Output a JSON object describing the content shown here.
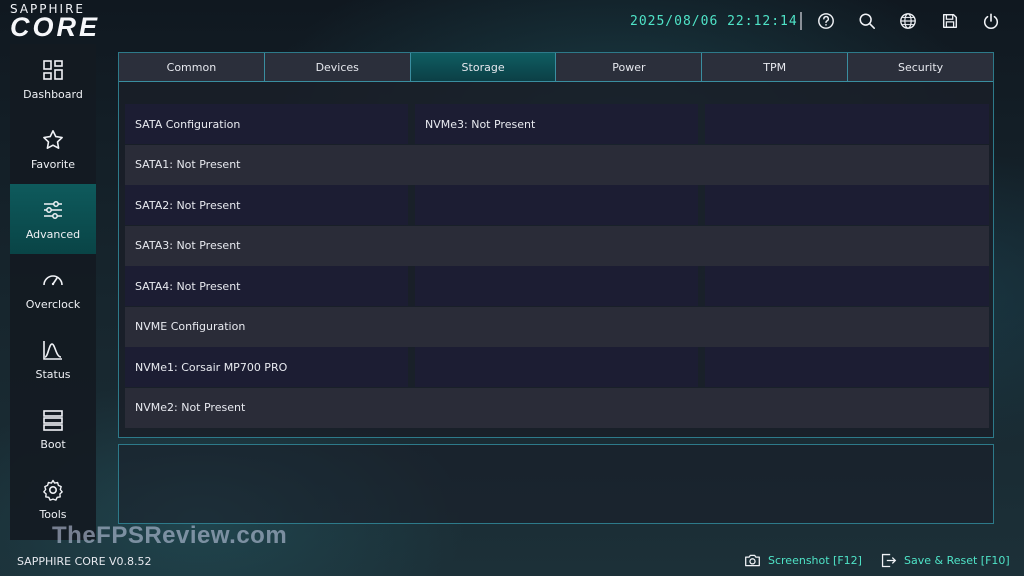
{
  "brand": {
    "top": "SAPPHIRE",
    "main": "CORE"
  },
  "datetime": "2025/08/06 22:12:14",
  "top_icons": [
    "help-icon",
    "search-icon",
    "globe-icon",
    "save-icon",
    "power-icon"
  ],
  "sidebar": {
    "items": [
      {
        "label": "Dashboard",
        "icon": "dashboard-icon",
        "active": false
      },
      {
        "label": "Favorite",
        "icon": "star-icon",
        "active": false
      },
      {
        "label": "Advanced",
        "icon": "sliders-icon",
        "active": true
      },
      {
        "label": "Overclock",
        "icon": "gauge-icon",
        "active": false
      },
      {
        "label": "Status",
        "icon": "chart-icon",
        "active": false
      },
      {
        "label": "Boot",
        "icon": "boot-icon",
        "active": false
      },
      {
        "label": "Tools",
        "icon": "gear-icon",
        "active": false
      }
    ]
  },
  "tabs": [
    {
      "label": "Common",
      "active": false
    },
    {
      "label": "Devices",
      "active": false
    },
    {
      "label": "Storage",
      "active": true
    },
    {
      "label": "Power",
      "active": false
    },
    {
      "label": "TPM",
      "active": false
    },
    {
      "label": "Security",
      "active": false
    }
  ],
  "storage": {
    "col1": [
      "SATA Configuration",
      "SATA1: Not Present",
      "SATA2: Not Present",
      "SATA3: Not Present",
      "SATA4: Not Present",
      "NVME Configuration",
      "NVMe1: Corsair MP700 PRO",
      "NVMe2: Not Present"
    ],
    "col2": [
      "NVMe3: Not Present",
      "",
      "",
      "",
      "",
      "",
      "",
      ""
    ],
    "col3": [
      "",
      "",
      "",
      "",
      "",
      "",
      "",
      ""
    ]
  },
  "footer": {
    "version": "SAPPHIRE CORE V0.8.52",
    "watermark": "TheFPSReview.com",
    "screenshot_label": "Screenshot [F12]",
    "save_reset_label": "Save & Reset [F10]"
  },
  "colors": {
    "accent": "#4fe3c7",
    "active_bg": "#0e5a5c",
    "border": "#2d7a8a"
  }
}
